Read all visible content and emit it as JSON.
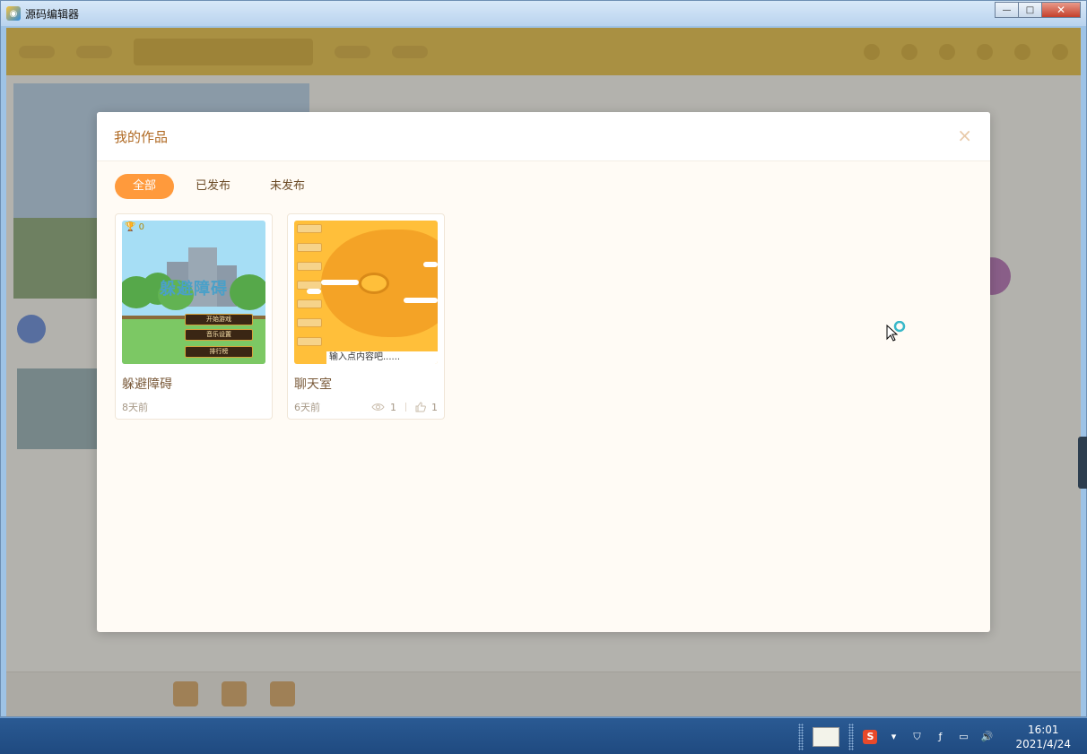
{
  "window": {
    "title": "源码编辑器",
    "controls": {
      "minimize": "—",
      "maximize": "□",
      "close": "✕"
    }
  },
  "modal": {
    "title": "我的作品",
    "close_symbol": "×",
    "tabs": [
      {
        "label": "全部",
        "active": true
      },
      {
        "label": "已发布",
        "active": false
      },
      {
        "label": "未发布",
        "active": false
      }
    ],
    "works": [
      {
        "title": "躲避障碍",
        "time": "8天前",
        "thumb": {
          "trophy_count": "0",
          "game_title": "躲避障碍",
          "buttons": [
            "开始游戏",
            "音乐设置",
            "排行榜"
          ]
        }
      },
      {
        "title": "聊天室",
        "time": "6天前",
        "views": "1",
        "likes": "1",
        "thumb": {
          "input_placeholder": "输入点内容吧......"
        }
      }
    ]
  },
  "taskbar": {
    "time": "16:01",
    "date": "2021/4/24",
    "sogou_label": "S"
  },
  "colors": {
    "accent": "#ff9a3c",
    "modal_title": "#b06a24",
    "toolbar": "#d9b23b"
  }
}
